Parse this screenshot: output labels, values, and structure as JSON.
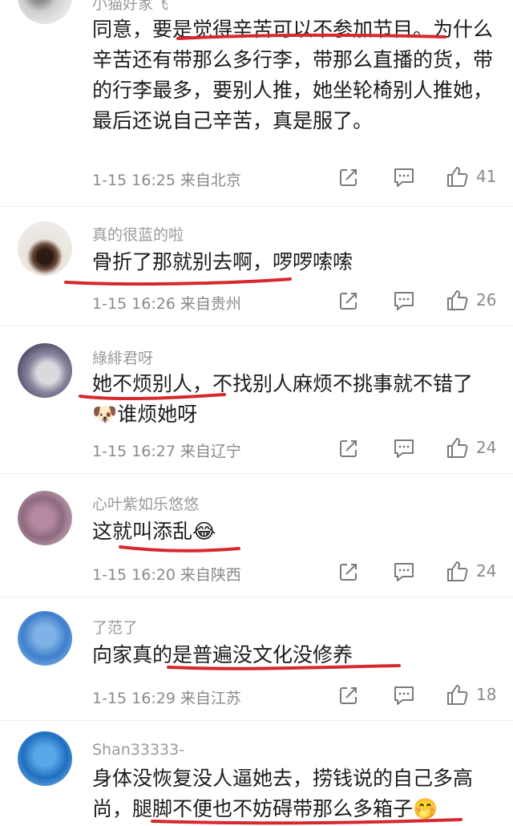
{
  "comments": [
    {
      "username": "小猫好家飞",
      "text": "同意，要是觉得辛苦可以不参加节目。为什么辛苦还有带那么多行李，带那么直播的货，带的行李最多，要别人推，她坐轮椅别人推她，最后还说自己辛苦，真是服了。",
      "time": "1-15 16:25",
      "location": "来自北京",
      "likes": "41"
    },
    {
      "username": "真的很蓝的啦",
      "text": "骨折了那就别去啊，啰啰嗦嗦",
      "time": "1-15 16:26",
      "location": "来自贵州",
      "likes": "26"
    },
    {
      "username": "綠緋君呀",
      "text": "她不烦别人，不找别人麻烦不挑事就不错了🐶谁烦她呀",
      "time": "1-15 16:27",
      "location": "来自辽宁",
      "likes": "24"
    },
    {
      "username": "心叶紫如乐悠悠",
      "text": "这就叫添乱😂",
      "time": "1-15 16:20",
      "location": "来自陕西",
      "likes": "24"
    },
    {
      "username": "了范了",
      "text": "向家真的是普遍没文化没修养",
      "time": "1-15 16:29",
      "location": "来自江苏",
      "likes": "18"
    },
    {
      "username": "Shan33333-",
      "text": "身体没恢复没人逼她去，捞钱说的自己多高尚，腿脚不便也不妨碍带那么多箱子🤭",
      "time": "",
      "location": "",
      "likes": ""
    }
  ],
  "colors": {
    "annotation_red": "#d7282f",
    "meta_gray": "#8a8a8a",
    "username_gray": "#9a9a9a"
  },
  "icons": [
    "share-icon",
    "comment-icon",
    "like-icon"
  ]
}
